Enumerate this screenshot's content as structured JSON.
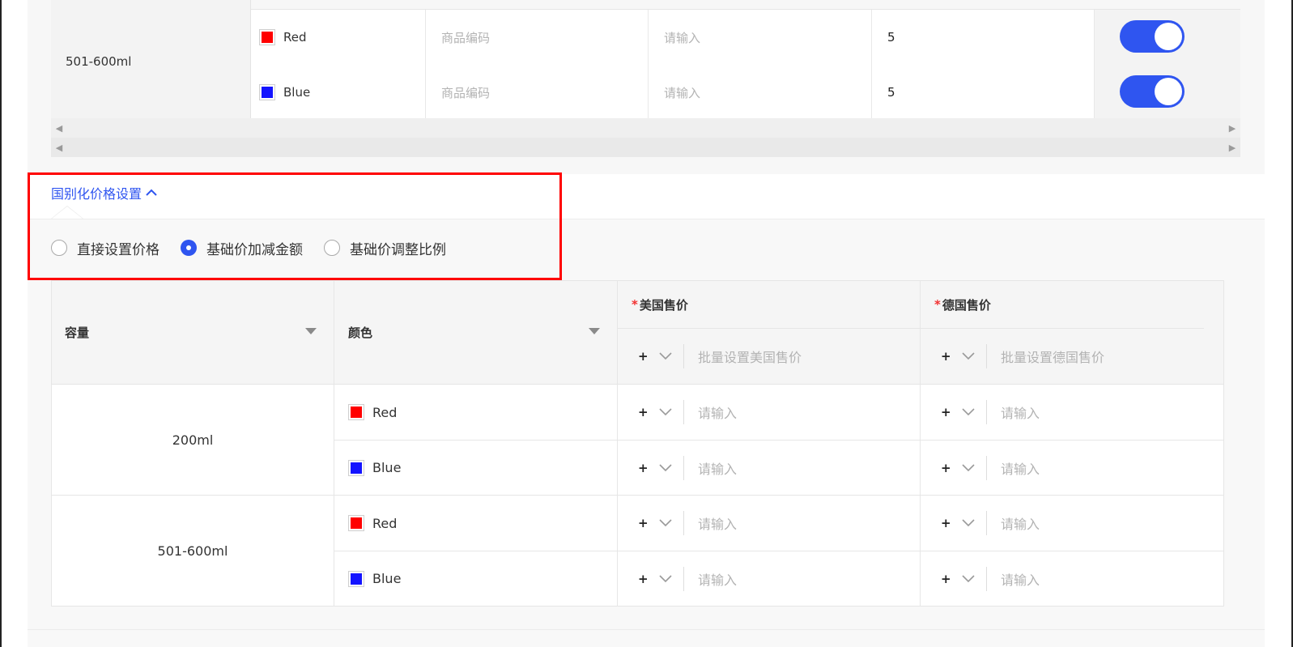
{
  "colors": {
    "accent": "#2f55f0",
    "red": "#ff0000",
    "blue": "#1414ff",
    "required": "#f23030",
    "highlight": "#ff0000"
  },
  "top_table": {
    "capacity": "501-600ml",
    "rows": [
      {
        "color_name": "Red",
        "swatch": "#ff0000",
        "code_placeholder": "商品编码",
        "input_placeholder": "请输入",
        "qty": "5",
        "enabled": true
      },
      {
        "color_name": "Blue",
        "swatch": "#1414ff",
        "code_placeholder": "商品编码",
        "input_placeholder": "请输入",
        "qty": "5",
        "enabled": true
      }
    ]
  },
  "settings": {
    "toggle_label": "国别化价格设置",
    "toggle_icon": "chevron-up-icon",
    "radios": [
      {
        "label": "直接设置价格",
        "selected": false
      },
      {
        "label": "基础价加减金额",
        "selected": true
      },
      {
        "label": "基础价调整比例",
        "selected": false
      }
    ]
  },
  "price_table": {
    "headers": {
      "capacity": "容量",
      "color": "颜色",
      "us_price": "美国售价",
      "de_price": "德国售价",
      "required_mark": "*"
    },
    "batch": {
      "sign": "+",
      "us_placeholder": "批量设置美国售价",
      "de_placeholder": "批量设置德国售价"
    },
    "groups": [
      {
        "capacity": "200ml",
        "rows": [
          {
            "color_name": "Red",
            "swatch": "#ff0000",
            "sign": "+",
            "placeholder": "请输入"
          },
          {
            "color_name": "Blue",
            "swatch": "#1414ff",
            "sign": "+",
            "placeholder": "请输入"
          }
        ]
      },
      {
        "capacity": "501-600ml",
        "rows": [
          {
            "color_name": "Red",
            "swatch": "#ff0000",
            "sign": "+",
            "placeholder": "请输入"
          },
          {
            "color_name": "Blue",
            "swatch": "#1414ff",
            "sign": "+",
            "placeholder": "请输入"
          }
        ]
      }
    ]
  }
}
